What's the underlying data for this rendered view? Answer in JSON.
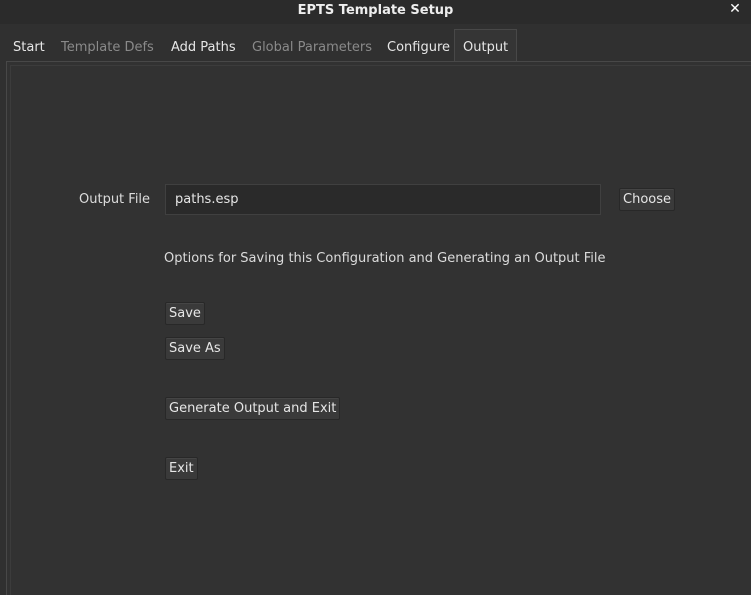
{
  "window": {
    "title": "EPTS Template Setup",
    "close_glyph": "✕"
  },
  "tabs": [
    {
      "label": "Start",
      "state": "normal"
    },
    {
      "label": "Template Defs",
      "state": "disabled"
    },
    {
      "label": "Add Paths",
      "state": "normal"
    },
    {
      "label": "Global Parameters",
      "state": "disabled"
    },
    {
      "label": "Configure",
      "state": "normal"
    },
    {
      "label": "Output",
      "state": "active"
    }
  ],
  "output": {
    "file_label": "Output File",
    "file_value": "paths.esp",
    "choose_label": "Choose",
    "options_text": "Options for Saving this Configuration and Generating an Output File",
    "save_label": "Save",
    "save_as_label": "Save As",
    "generate_label": "Generate Output and Exit",
    "exit_label": "Exit"
  },
  "colors": {
    "background": "#303030",
    "field_background": "#2a2a2a",
    "button_background": "#3a3a3a",
    "disabled_text": "#8a8a8a"
  }
}
